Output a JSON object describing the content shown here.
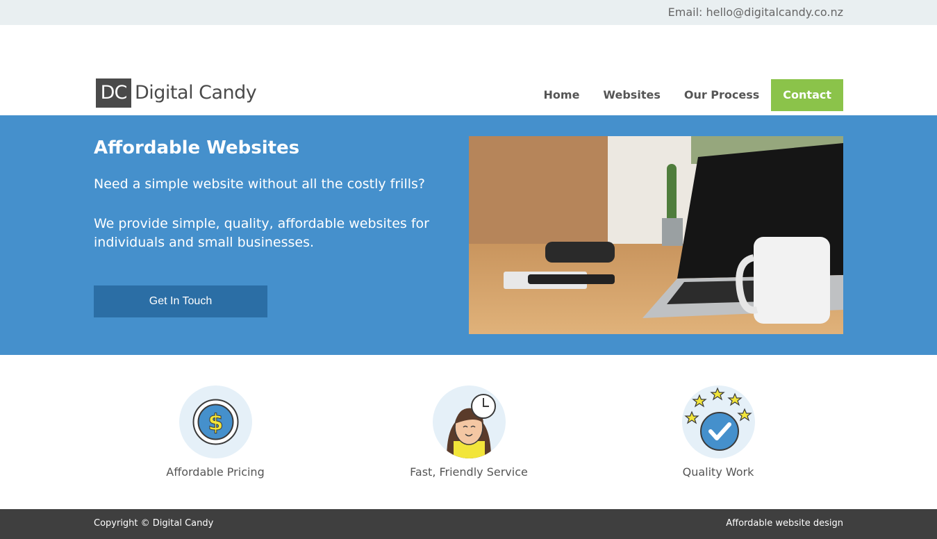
{
  "topbar": {
    "email_text": "Email: hello@digitalcandy.co.nz"
  },
  "header": {
    "logo_mark": "DC",
    "logo_text": "Digital Candy",
    "nav": [
      {
        "label": "Home"
      },
      {
        "label": "Websites"
      },
      {
        "label": "Our Process"
      },
      {
        "label": "Contact",
        "active": true
      }
    ]
  },
  "hero": {
    "title": "Affordable Websites",
    "line1": "Need a simple website without all the costly frills?",
    "line2": "We provide simple, quality, affordable websites for individuals and small businesses.",
    "cta_label": "Get In Touch",
    "image_icon": "laptop-desk-photo"
  },
  "features": [
    {
      "label": "Affordable Pricing",
      "icon": "dollar-coin-icon"
    },
    {
      "label": "Fast, Friendly Service",
      "icon": "person-clock-icon"
    },
    {
      "label": "Quality Work",
      "icon": "stars-check-icon"
    }
  ],
  "footer": {
    "copyright": "Copyright © Digital Candy",
    "tagline": "Affordable website design"
  },
  "colors": {
    "accent_green": "#8bc34a",
    "hero_blue": "#4590cc",
    "cta_blue": "#2b6ea5",
    "footer_dark": "#3f3f3f"
  }
}
